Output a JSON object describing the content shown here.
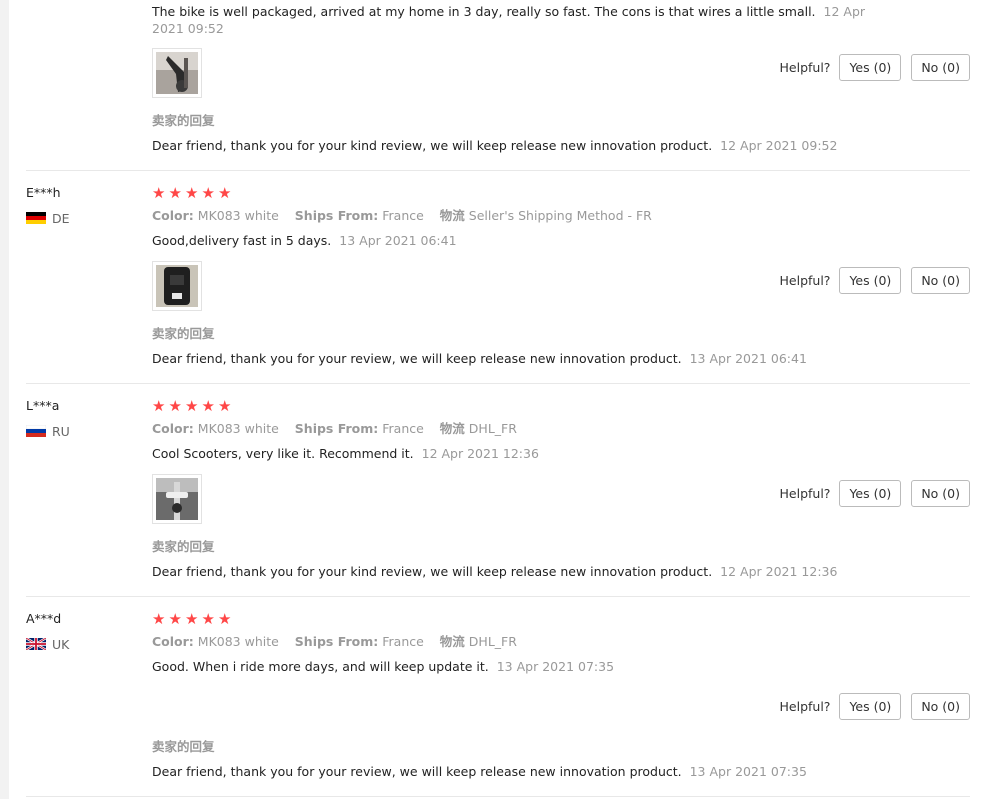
{
  "labels": {
    "helpful": "Helpful?",
    "reply_title": "卖家的回复",
    "color_key": "Color:",
    "ships_key": "Ships From:",
    "logistics_key": "物流"
  },
  "colors": {
    "star": "#ff4747",
    "muted": "#999999",
    "border": "#e8e8e8"
  },
  "reviews": [
    {
      "user": "",
      "country": "",
      "text": "The bike is well packaged, arrived at my home in 3 day, really so fast. The cons is that wires a little small.",
      "time": "12 Apr 2021 09:52",
      "yes": "Yes (0)",
      "no": "No (0)",
      "reply": "Dear friend, thank you for your kind review, we will keep release new innovation product.",
      "reply_time": "12 Apr 2021 09:52"
    },
    {
      "user": "E***h",
      "country": "DE",
      "flag": "de-flag-icon",
      "rating": 5,
      "color": "MK083 white",
      "ships_from": "France",
      "logistics": "Seller's Shipping Method - FR",
      "text": "Good,delivery fast in 5 days.",
      "time": "13 Apr 2021 06:41",
      "yes": "Yes (0)",
      "no": "No (0)",
      "reply": "Dear friend, thank you for your review, we will keep release new innovation product.",
      "reply_time": "13 Apr 2021 06:41"
    },
    {
      "user": "L***a",
      "country": "RU",
      "flag": "ru-flag-icon",
      "rating": 5,
      "color": "MK083 white",
      "ships_from": "France",
      "logistics": "DHL_FR",
      "text": "Cool Scooters, very like it. Recommend it.",
      "time": "12 Apr 2021 12:36",
      "yes": "Yes (0)",
      "no": "No (0)",
      "reply": "Dear friend, thank you for your kind review, we will keep release new innovation product.",
      "reply_time": "12 Apr 2021 12:36"
    },
    {
      "user": "A***d",
      "country": "UK",
      "flag": "uk-flag-icon",
      "rating": 5,
      "color": "MK083 white",
      "ships_from": "France",
      "logistics": "DHL_FR",
      "text": "Good. When i ride more days, and will keep update it.",
      "time": "13 Apr 2021 07:35",
      "yes": "Yes (0)",
      "no": "No (0)",
      "reply": "Dear friend, thank you for your review, we will keep release new innovation product.",
      "reply_time": "13 Apr 2021 07:35"
    }
  ]
}
